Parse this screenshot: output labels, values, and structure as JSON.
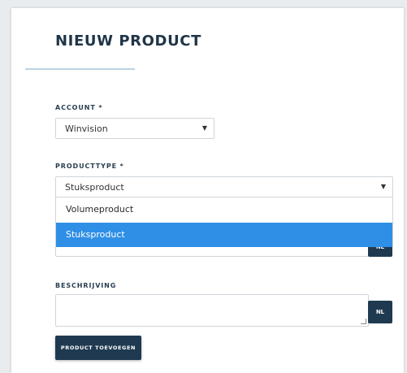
{
  "form": {
    "title": "NIEUW PRODUCT",
    "account": {
      "label": "ACCOUNT *",
      "value": "Winvision"
    },
    "producttype": {
      "label": "PRODUCTTYPE *",
      "value": "Stuksproduct",
      "options": [
        "Volumeproduct",
        "Stuksproduct"
      ],
      "highlighted_option": "Stuksproduct"
    },
    "naam": {
      "lang_badge": "NL"
    },
    "beschrijving": {
      "label": "BESCHRIJVING",
      "lang_badge": "NL"
    },
    "submit_label": "PRODUCT TOEVOEGEN"
  },
  "colors": {
    "primary_dark": "#1f3a50",
    "selection_blue": "#2f8fe6",
    "accent_rule": "#b9d3e4"
  },
  "icons": {
    "dropdown_caret": "caret-down-icon",
    "resize_handle": "resize-grip-icon"
  }
}
